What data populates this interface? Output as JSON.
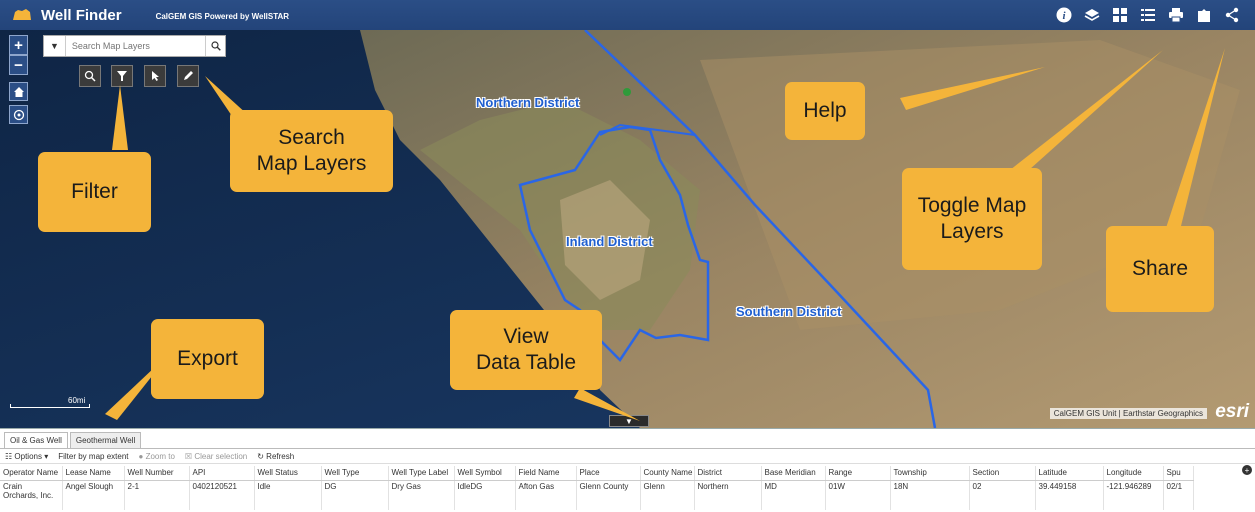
{
  "header": {
    "title": "Well Finder",
    "subtitle": "CalGEM GIS Powered by WellSTAR",
    "tools": [
      "help-icon",
      "layers-icon",
      "grid-icon",
      "list-icon",
      "print-icon",
      "export-icon",
      "share-icon"
    ]
  },
  "map": {
    "search_placeholder": "Search Map Layers",
    "districts": [
      "Northern District",
      "Inland District",
      "Southern District"
    ],
    "attribution": "CalGEM GIS Unit | Earthstar Geographics",
    "esri_label": "esri",
    "scale_label": "60mi",
    "zoom_in": "+",
    "zoom_out": "−"
  },
  "callouts": {
    "help": "Help",
    "search": "Search\nMap Layers",
    "filter": "Filter",
    "toggle": "Toggle Map\nLayers",
    "share": "Share",
    "export": "Export",
    "view": "View\nData Table"
  },
  "panel": {
    "tabs": [
      "Oil & Gas Well",
      "Geothermal Well"
    ],
    "toolbar": {
      "options": "Options",
      "filter_extent": "Filter by map extent",
      "zoom_to": "Zoom to",
      "clear_selection": "Clear selection",
      "refresh": "Refresh"
    },
    "columns": [
      "Operator Name",
      "Lease Name",
      "Well Number",
      "API",
      "Well Status",
      "Well Type",
      "Well Type Label",
      "Well Symbol",
      "Field Name",
      "Place",
      "County Name",
      "District",
      "Base Meridian",
      "Range",
      "Township",
      "Section",
      "Latitude",
      "Longitude",
      "Spu"
    ],
    "rows": [
      [
        "Crain Orchards, Inc.",
        "Angel Slough",
        "2-1",
        "0402120521",
        "Idle",
        "DG",
        "Dry Gas",
        "IdleDG",
        "Afton Gas",
        "Glenn County",
        "Glenn",
        "Northern",
        "MD",
        "01W",
        "18N",
        "02",
        "39.449158",
        "-121.946289",
        "02/1"
      ]
    ]
  },
  "colors": {
    "header": "#2b4e86",
    "callout": "#f4b43a",
    "district_line": "#2a66e6"
  }
}
